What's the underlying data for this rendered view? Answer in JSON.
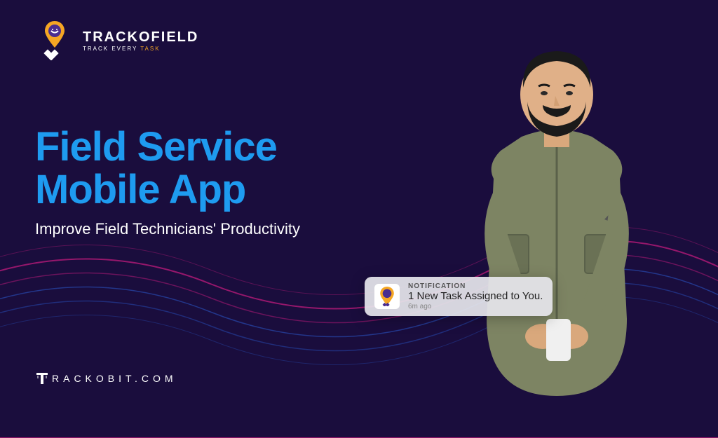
{
  "logo": {
    "title": "TRACKOFIELD",
    "tagline_prefix": "TRACK EVERY ",
    "tagline_highlight": "TASK"
  },
  "hero": {
    "title_line1": "Field Service",
    "title_line2": "Mobile App",
    "subtitle": "Improve Field Technicians' Productivity"
  },
  "notification": {
    "label": "NOTIFICATION",
    "body": "1 New Task Assigned to You.",
    "time": "6m ago",
    "icon_name": "trackofield-pin-icon"
  },
  "footer": {
    "brand": "RACKOBIT.COM",
    "icon_name": "trackobit-t-icon"
  },
  "icons": {
    "logo_pin": "pin-icon"
  }
}
